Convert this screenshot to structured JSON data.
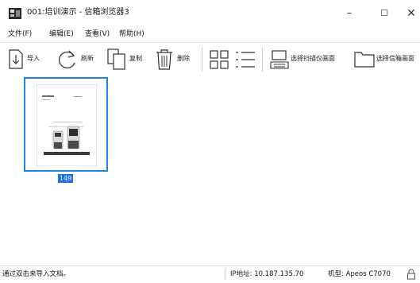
{
  "window": {
    "title": "001:培训演示 - 信箱浏览器3",
    "minimize": "–",
    "maximize": "☐",
    "close": "✕"
  },
  "menu": [
    "文件(F)",
    "编辑(E)",
    "查看(V)",
    "帮助(H)"
  ],
  "toolbar": {
    "import_label": "导入",
    "refresh_label": "刷新",
    "copy_label": "复制",
    "delete_label": "删除",
    "select_scanner_label": "选择扫描仪画面",
    "select_mailbox_label": "选择信箱画面"
  },
  "thumbnail": {
    "page_number": "149"
  },
  "status": {
    "hint": "通过双击来导入文档。",
    "ip_text": "IP地址: 10.187.135.70",
    "model_text": "机型: Apeos C7070"
  },
  "icons": {
    "app": "app-scanner-icon",
    "lock": "lock-icon"
  },
  "colors": {
    "selection": "#1e88e5",
    "page_badge": "#1e6fe0"
  }
}
